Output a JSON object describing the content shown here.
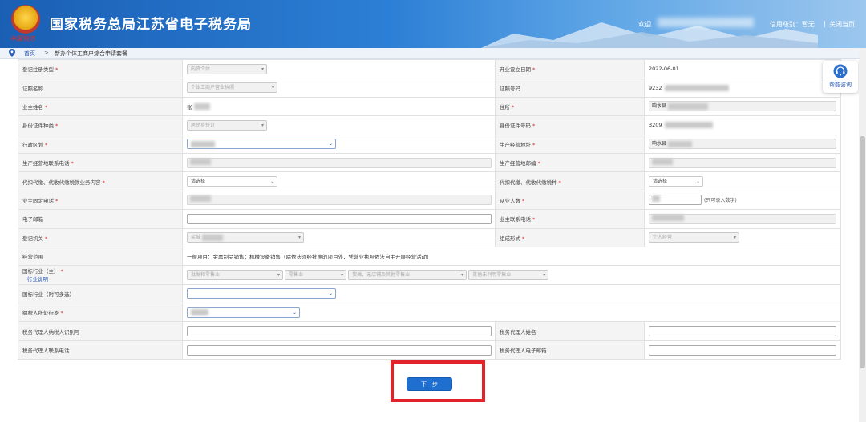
{
  "header": {
    "title": "国家税务总局江苏省电子税务局",
    "logo_text": "中国税务",
    "welcome": "欢迎",
    "credit_text": "信用级别：暂无",
    "separator": "|",
    "close_label": "关闭当页"
  },
  "breadcrumb": {
    "home": "首页",
    "arrow": ">",
    "current": "新办个体工商户综合申请套餐"
  },
  "help": {
    "label": "帮能咨询"
  },
  "form": {
    "reg_type_label": "登记注册类型",
    "reg_type_value": "内资个体",
    "open_date_label": "开业设立日期",
    "open_date_value": "2022-06-01",
    "cert_name_label": "证照名称",
    "cert_name_value": "个体工商户营业执照",
    "cert_no_label": "证照号码",
    "cert_no_value": "9232",
    "owner_name_label": "业主姓名",
    "owner_name_value": "张",
    "address_label": "住所",
    "address_value": "响水县",
    "id_type_label": "身份证件种类",
    "id_type_value": "居民身份证",
    "id_no_label": "身份证件号码",
    "id_no_value": "3209",
    "admin_region_label": "行政区划",
    "biz_address_label": "生产经营地址",
    "biz_address_value": "响水县",
    "biz_phone_label": "生产经营地联系电话",
    "biz_postcode_label": "生产经营地邮编",
    "withhold_label": "代扣代缴、代收代缴税款业务内容",
    "withhold_value": "请选择",
    "withhold_tax_label": "代扣代缴、代收代缴税种",
    "withhold_tax_value": "请选择",
    "owner_phone_label": "业主固定电话",
    "staff_label": "从业人数",
    "staff_hint": "(只可录入数字)",
    "email_label": "电子邮箱",
    "contact_phone_label": "业主联系电话",
    "reg_office_label": "登记机关",
    "reg_office_value": "盐城",
    "org_form_label": "组成形式",
    "org_form_value": "个人经营",
    "scope_label": "经营范围",
    "scope_value": "一般项目：金属制品销售；机械设备销售（除依法须经批准的项目外，凭营业执照依法自主开展经营活动）",
    "industry_main_label": "国标行业（主）",
    "industry_link": "行业说明",
    "industry_main_values": [
      "批发和零售业",
      "零售业",
      "货摊、无店铺及其他零售业",
      "其他未列明零售业"
    ],
    "industry_extra_label": "国标行业（附可多选）",
    "street_label": "纳税人所处街乡",
    "agent_id_label": "税务代理人纳税人识别号",
    "agent_name_label": "税务代理人姓名",
    "agent_phone_label": "税务代理人联系电话",
    "agent_email_label": "税务代理人电子邮箱",
    "required_mark": "*"
  },
  "next_button": "下一步"
}
